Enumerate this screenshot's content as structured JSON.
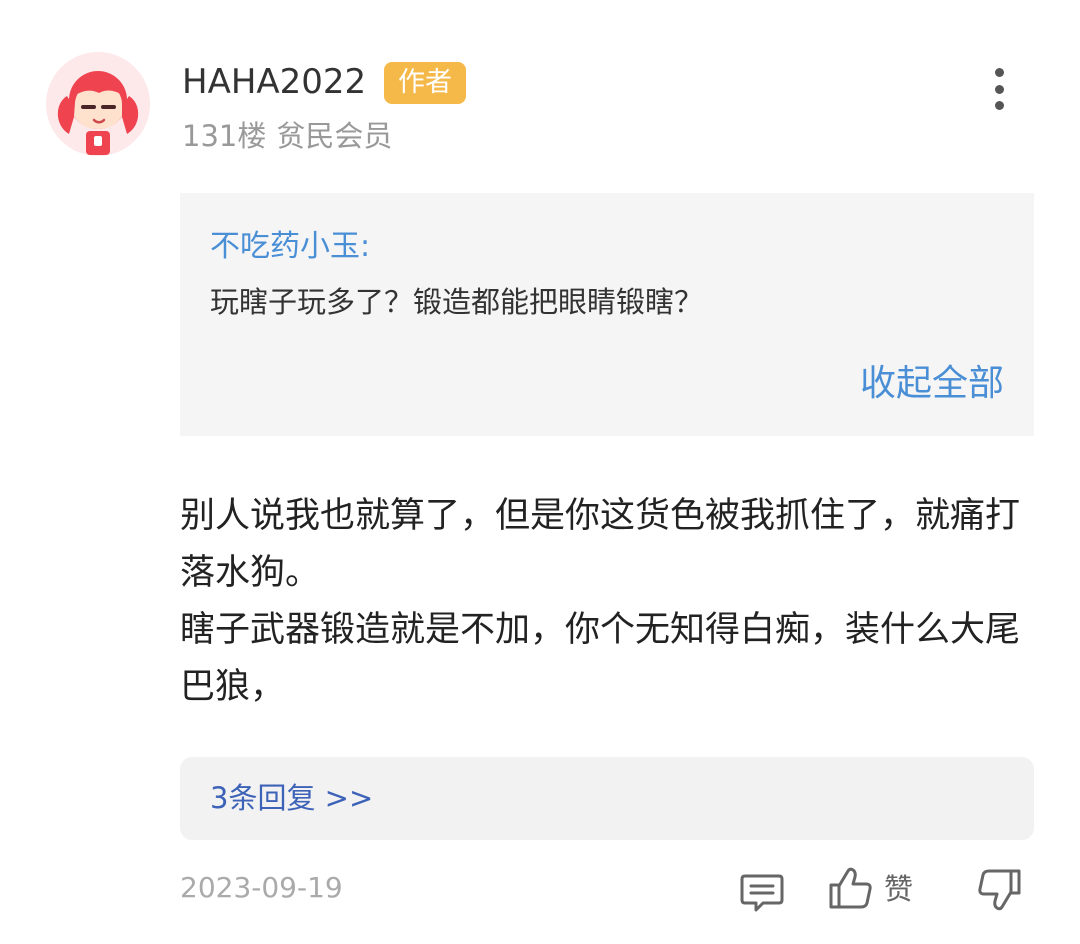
{
  "post": {
    "username": "HAHA2022",
    "badge": "作者",
    "floor": "131楼",
    "member_level": "贫民会员",
    "quote": {
      "author": "不吃药小玉:",
      "text": "玩瞎子玩多了？锻造都能把眼睛锻瞎？",
      "collapse_label": "收起全部"
    },
    "body": [
      "别人说我也就算了，但是你这货色被我抓住了，就痛打落水狗。",
      "瞎子武器锻造就是不加，你个无知得白痴，装什么大尾巴狼，"
    ],
    "replies_label": "3条回复 >>",
    "date": "2023-09-19",
    "actions": {
      "like_label": "赞"
    }
  },
  "icons": {
    "avatar": "red-hair-girl-avatar",
    "more": "vertical-ellipsis-icon",
    "comment": "comment-icon",
    "like": "thumbs-up-icon",
    "dislike": "thumbs-down-icon"
  },
  "colors": {
    "badge": "#f5b94a",
    "link": "#4a8fd6",
    "reply_link": "#3d63b8",
    "quote_bg": "#f5f5f5",
    "muted_text": "#999999"
  }
}
